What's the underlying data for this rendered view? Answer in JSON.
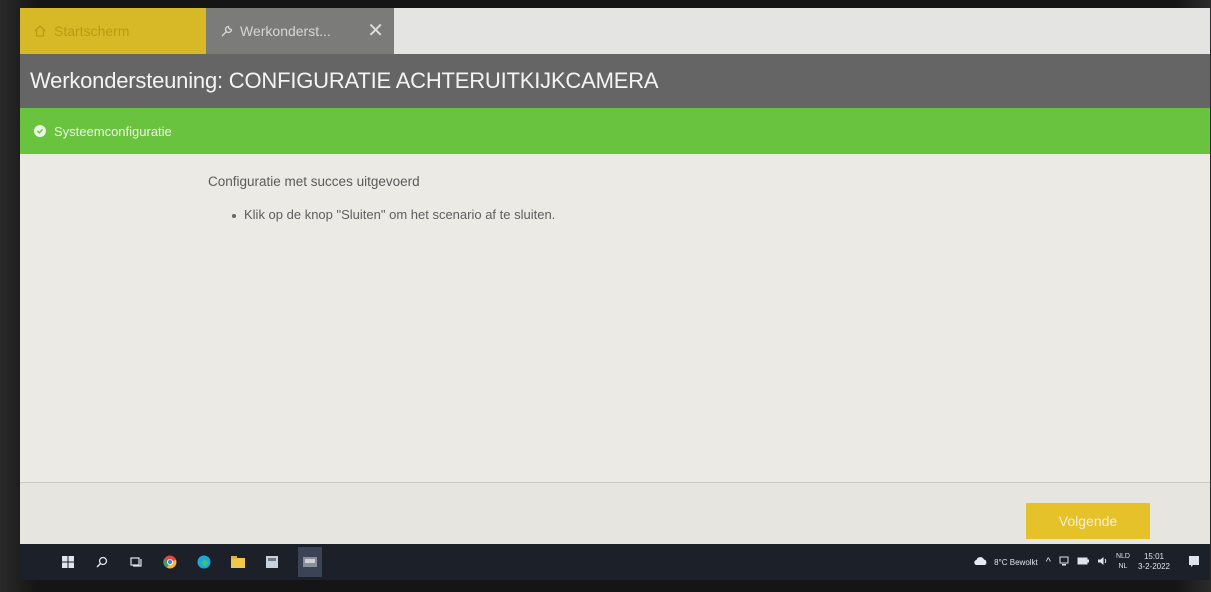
{
  "tabs": [
    {
      "label": "Startscherm",
      "icon": "home-icon"
    },
    {
      "label": "Werkonderst...",
      "icon": "wrench-icon",
      "close": "✕"
    }
  ],
  "header": {
    "title": "Werkondersteuning: CONFIGURATIE ACHTERUITKIJKCAMERA"
  },
  "section": {
    "label": "Systeemconfiguratie"
  },
  "content": {
    "message": "Configuratie met succes uitgevoerd",
    "instruction": "Klik op de knop \"Sluiten\" om het scenario af te sluiten."
  },
  "footer": {
    "next_label": "Volgende"
  },
  "taskbar": {
    "weather": "8°C Bewolkt",
    "lang_top": "NLD",
    "lang_bottom": "NL",
    "time": "15:01",
    "date": "3-2-2022"
  },
  "colors": {
    "accent_yellow": "#e6c22a",
    "section_green": "#69c33f",
    "titlebar_gray": "#656565"
  }
}
